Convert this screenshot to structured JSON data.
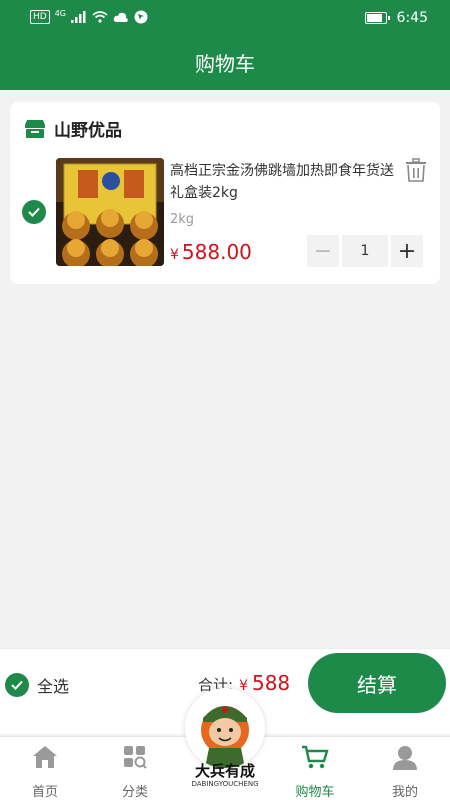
{
  "status_bar": {
    "left_badges": [
      "HD",
      "4G"
    ],
    "time": "6:45",
    "battery_level": 0.9
  },
  "header": {
    "title": "购物车"
  },
  "store": {
    "name": "山野优品",
    "checked": true,
    "items": [
      {
        "title": "高档正宗金汤佛跳墙加热即食年货送礼盒装2kg",
        "spec": "2kg",
        "currency": "¥",
        "price": "588.00",
        "quantity": "1",
        "minus": "−",
        "plus": "+",
        "checked": true
      }
    ]
  },
  "footer": {
    "select_all_label": "全选",
    "total_label": "合计:",
    "currency": "¥",
    "total_value": "588",
    "checkout_label": "结算"
  },
  "tabbar": {
    "items": [
      {
        "label": "首页",
        "icon": "home-icon",
        "active": false
      },
      {
        "label": "分类",
        "icon": "category-icon",
        "active": false
      },
      {
        "label": "购物车",
        "icon": "cart-icon",
        "active": true
      },
      {
        "label": "我的",
        "icon": "profile-icon",
        "active": false
      }
    ],
    "center_logo": {
      "text": "大兵有成",
      "sub": "DABINGYOUCHENG"
    }
  },
  "colors": {
    "primary": "#1e8a4a",
    "price": "#d0121b",
    "background": "#f2f2f2"
  }
}
